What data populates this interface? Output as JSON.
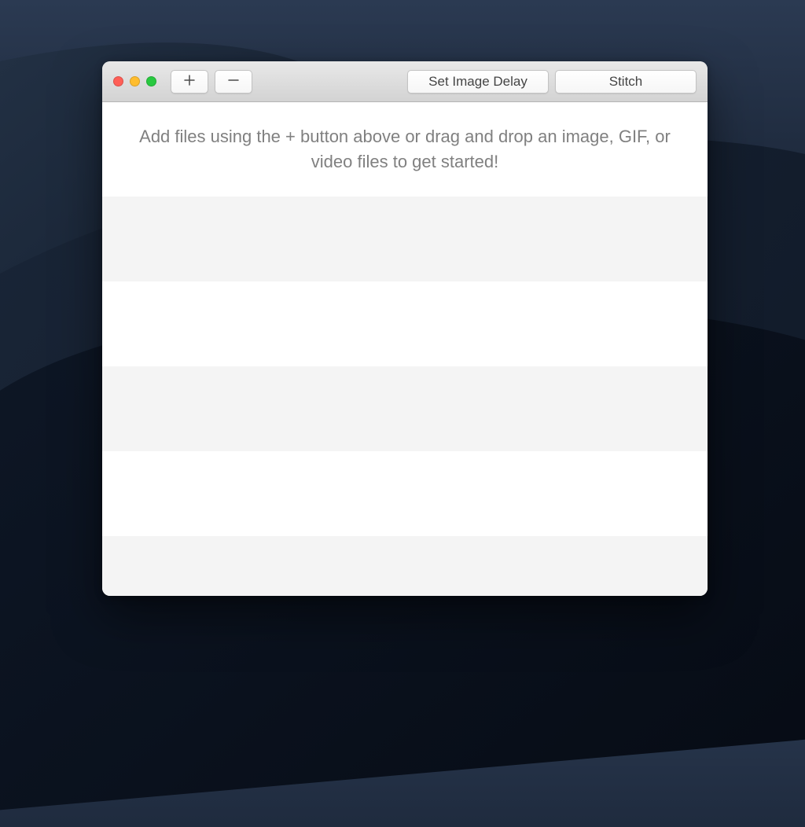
{
  "toolbar": {
    "add_label": "Add file",
    "remove_label": "Remove file",
    "set_delay_label": "Set Image Delay",
    "stitch_label": "Stitch"
  },
  "main": {
    "instructions": "Add files using the + button above or drag and drop an image, GIF, or video files to get started!"
  },
  "colors": {
    "traffic_close": "#ff5f57",
    "traffic_minimize": "#ffbd2e",
    "traffic_zoom": "#28c940"
  }
}
